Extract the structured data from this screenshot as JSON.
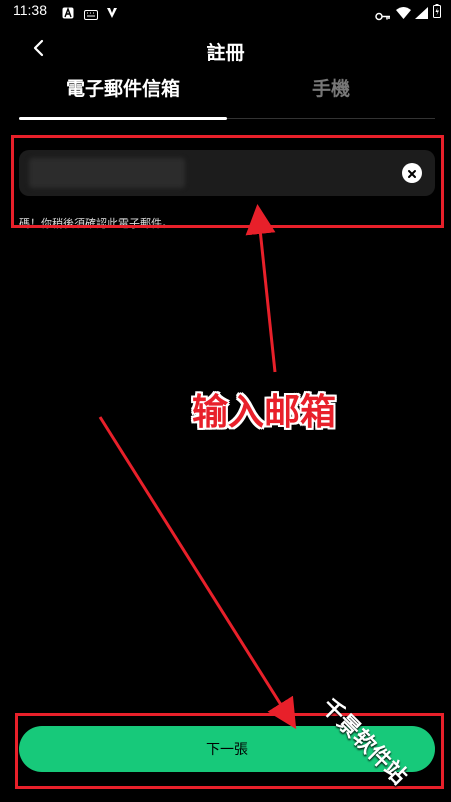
{
  "status_bar": {
    "time": "11:38",
    "left_icons": [
      "a-notification-icon",
      "keyboard-icon",
      "v-notification-icon"
    ],
    "right_icons": [
      "key-icon",
      "wifi-icon",
      "signal-icon",
      "battery-icon"
    ]
  },
  "header": {
    "title": "註冊",
    "back_icon": "chevron-left-icon"
  },
  "tabs": [
    {
      "label": "電子郵件信箱",
      "active": true
    },
    {
      "label": "手機",
      "active": false
    }
  ],
  "email_input": {
    "value": "",
    "clear_icon": "close-circle-icon"
  },
  "hint": "碼！你稍後須確認此電子郵件。",
  "annotation": {
    "label": "输入邮箱",
    "color": "#e8202a"
  },
  "next_button": {
    "label": "下一張",
    "color": "#17c97a"
  },
  "watermark": "千景软件站"
}
